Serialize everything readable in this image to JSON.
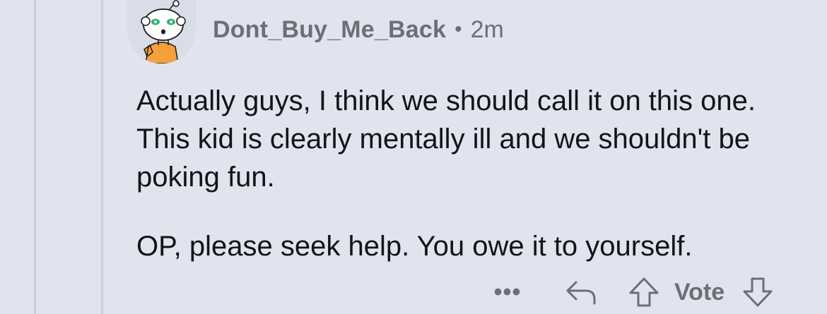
{
  "comment": {
    "username": "Dont_Buy_Me_Back",
    "separator": "•",
    "age": "2m",
    "avatar_icon": "snoo-avatar-icon",
    "paragraphs": [
      "Actually guys, I think we should call it on this one. This kid is clearly mentally ill and we shouldn't be poking fun.",
      "OP, please seek help. You owe it to yourself."
    ]
  },
  "actions": {
    "more_label": "•••",
    "reply_icon": "reply-icon",
    "upvote_icon": "upvote-arrow-icon",
    "vote_label": "Vote",
    "downvote_icon": "downvote-arrow-icon"
  },
  "colors": {
    "background": "#dfe4ee",
    "meta_text": "#6c6f76",
    "body_text": "#121416",
    "thread_line": "#ccd1dc",
    "avatar_shirt": "#f5a03a"
  }
}
